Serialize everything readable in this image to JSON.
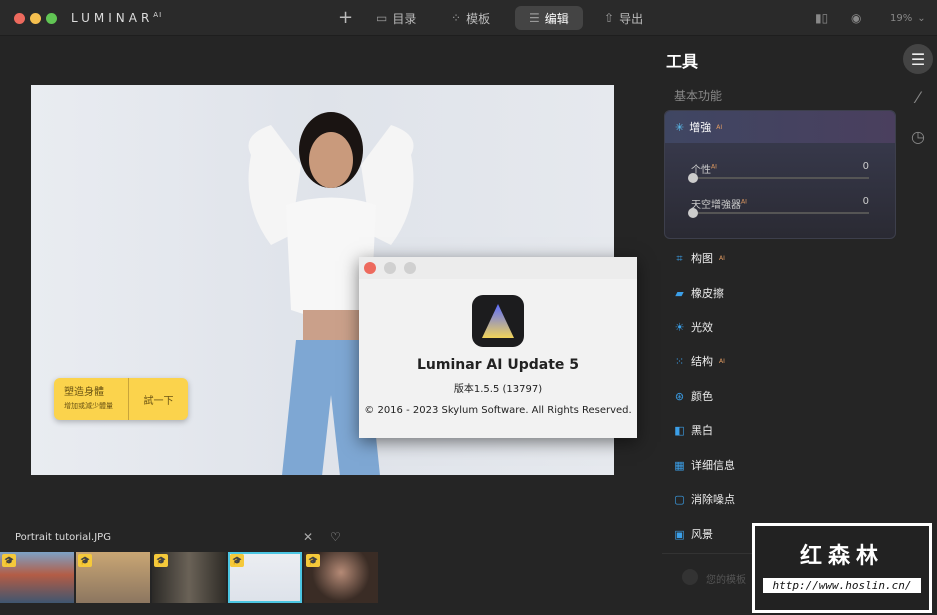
{
  "app": {
    "brand": "LUMINAR",
    "brand_sup": "AI"
  },
  "nav": {
    "add": "+",
    "catalog": "目录",
    "templates": "模板",
    "edit": "编辑",
    "export": "导出",
    "zoom": "19%"
  },
  "photo": {
    "hint_title": "塑造身體",
    "hint_sub": "增加或減少體量",
    "hint_action": "試一下"
  },
  "about": {
    "title": "Luminar AI Update 5",
    "version": "版本1.5.5 (13797)",
    "copyright": "© 2016 - 2023 Skylum Software. All Rights Reserved."
  },
  "filmstrip": {
    "filename": "Portrait tutorial.JPG"
  },
  "panel": {
    "title": "工具",
    "section": "基本功能",
    "enhance": {
      "label": "增強",
      "ai": "AI",
      "sliders": [
        {
          "label": "个性",
          "ai": "AI",
          "value": "0"
        },
        {
          "label": "天空增強器",
          "ai": "AI",
          "value": "0"
        }
      ]
    },
    "tools": [
      {
        "label": "构图",
        "ai": "AI",
        "icon": "crop-icon"
      },
      {
        "label": "橡皮擦",
        "ai": "",
        "icon": "eraser-icon"
      },
      {
        "label": "光效",
        "ai": "",
        "icon": "light-icon"
      },
      {
        "label": "结构",
        "ai": "AI",
        "icon": "structure-icon"
      },
      {
        "label": "颜色",
        "ai": "",
        "icon": "color-icon"
      },
      {
        "label": "黑白",
        "ai": "",
        "icon": "bw-icon"
      },
      {
        "label": "详细信息",
        "ai": "",
        "icon": "details-icon"
      },
      {
        "label": "消除噪点",
        "ai": "",
        "icon": "denoise-icon"
      },
      {
        "label": "风景",
        "ai": "",
        "icon": "landscape-icon"
      }
    ],
    "your_templates": "您的模板"
  },
  "watermark": {
    "name": "红森林",
    "url": "http://www.hoslin.cn/"
  }
}
